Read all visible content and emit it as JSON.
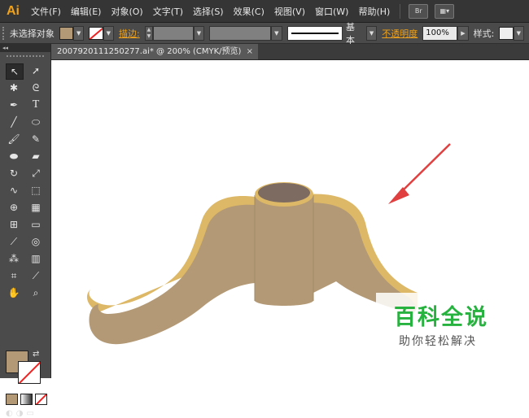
{
  "app": {
    "logo": "Ai"
  },
  "menubar": {
    "items": [
      "文件(F)",
      "编辑(E)",
      "对象(O)",
      "文字(T)",
      "选择(S)",
      "效果(C)",
      "视图(V)",
      "窗口(W)",
      "帮助(H)"
    ],
    "bridge_label": "Br"
  },
  "controlbar": {
    "selection_status": "未选择对象",
    "stroke_label": "描边:",
    "profile_label": "基本",
    "opacity_label": "不透明度",
    "opacity_value": "100%",
    "style_label": "样式:"
  },
  "document_tab": {
    "title": "2007920111250277.ai* @ 200% (CMYK/预览)",
    "close": "×"
  },
  "colors": {
    "fill": "#b39975",
    "highlight": "#ddb866",
    "cap": "#7d6b62",
    "arrow": "#e0403f",
    "watermark_title": "#27b23f"
  },
  "watermark": {
    "title": "百科全说",
    "subtitle": "助你轻松解决"
  },
  "tools": [
    "selection-icon",
    "direct-selection-icon",
    "magic-wand-icon",
    "lasso-icon",
    "pen-icon",
    "type-icon",
    "line-icon",
    "ellipse-icon",
    "paintbrush-icon",
    "pencil-icon",
    "blob-brush-icon",
    "eraser-icon",
    "rotate-icon",
    "scale-icon",
    "warp-icon",
    "free-transform-icon",
    "shape-builder-icon",
    "perspective-icon",
    "mesh-icon",
    "gradient-icon",
    "eyedropper-icon",
    "blend-icon",
    "symbol-sprayer-icon",
    "column-graph-icon",
    "artboard-icon",
    "slice-icon",
    "hand-icon",
    "zoom-icon"
  ]
}
